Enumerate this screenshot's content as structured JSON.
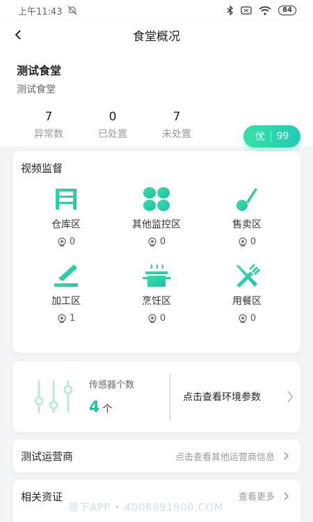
{
  "statusbar": {
    "time": "上午11:43",
    "battery": "84"
  },
  "nav": {
    "title": "食堂概况"
  },
  "canteen": {
    "name": "测试食堂",
    "subtitle": "测试食堂"
  },
  "stats": [
    {
      "value": "7",
      "label": "异常数"
    },
    {
      "value": "0",
      "label": "已处置"
    },
    {
      "value": "7",
      "label": "未处置"
    }
  ],
  "score": {
    "grade": "优",
    "value": "99"
  },
  "video": {
    "title": "视频监督",
    "zones": [
      {
        "label": "仓库区",
        "count": "0",
        "icon": "shelf-icon"
      },
      {
        "label": "其他监控区",
        "count": "0",
        "icon": "grid-icon"
      },
      {
        "label": "售卖区",
        "count": "0",
        "icon": "ladle-icon"
      },
      {
        "label": "加工区",
        "count": "1",
        "icon": "knife-icon"
      },
      {
        "label": "烹饪区",
        "count": "0",
        "icon": "pot-icon"
      },
      {
        "label": "用餐区",
        "count": "0",
        "icon": "fork-knife-icon"
      }
    ]
  },
  "sensor": {
    "label": "传感器个数",
    "count": "4",
    "unit": "个",
    "link": "点击查看环境参数"
  },
  "operator": {
    "title": "测试运营商",
    "link": "点击查看其他运营商信息"
  },
  "qualification": {
    "title": "相关资证",
    "link": "查看更多"
  },
  "watermark": "易下APP • 4008891800.COM",
  "colors": {
    "accent": "#22c69c",
    "accent_light": "#37e0a4"
  }
}
